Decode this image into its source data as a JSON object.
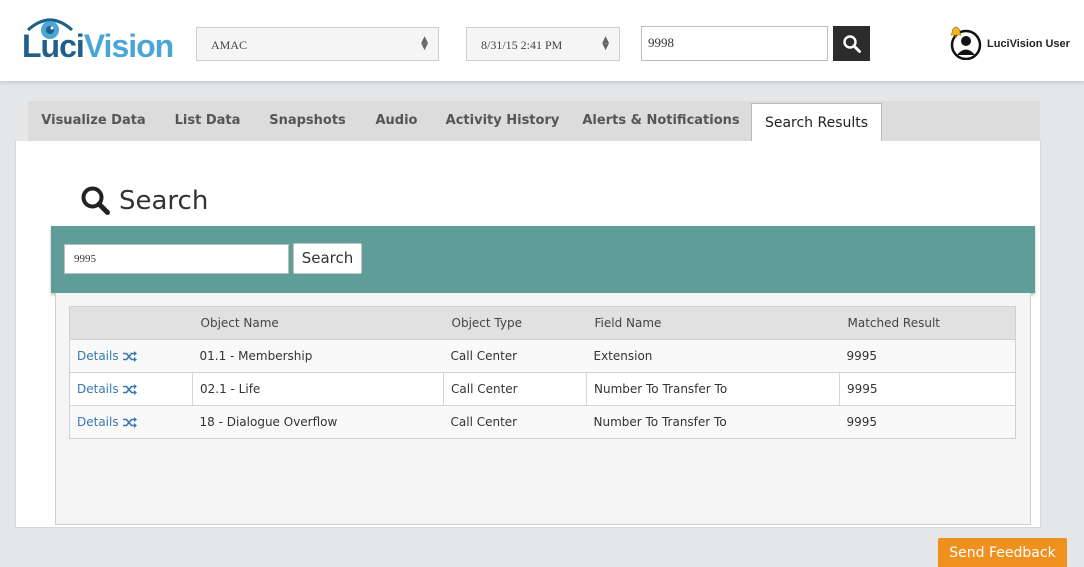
{
  "header": {
    "logo": {
      "luci": "Luci",
      "vision": "Vision"
    },
    "org_select": {
      "value": "AMAC"
    },
    "date_select": {
      "value": "8/31/15 2:41 PM"
    },
    "top_search": {
      "value": "9998"
    },
    "user": {
      "name": "LuciVision User"
    }
  },
  "tabs": [
    {
      "label": "Visualize Data"
    },
    {
      "label": "List Data"
    },
    {
      "label": "Snapshots"
    },
    {
      "label": "Audio"
    },
    {
      "label": "Activity History"
    },
    {
      "label": "Alerts & Notifications"
    },
    {
      "label": "Search Results",
      "active": true
    }
  ],
  "search": {
    "title": "Search",
    "input_value": "9995",
    "button_label": "Search"
  },
  "results": {
    "columns": [
      "",
      "Object Name",
      "Object Type",
      "Field Name",
      "Matched Result"
    ],
    "rows": [
      {
        "details": "Details",
        "object_name": "01.1 - Membership",
        "object_type": "Call Center",
        "field_name": "Extension",
        "matched": "9995"
      },
      {
        "details": "Details",
        "object_name": "02.1 - Life",
        "object_type": "Call Center",
        "field_name": "Number To Transfer To",
        "matched": "9995"
      },
      {
        "details": "Details",
        "object_name": "18 - Dialogue Overflow",
        "object_type": "Call Center",
        "field_name": "Number To Transfer To",
        "matched": "9995"
      }
    ]
  },
  "feedback": {
    "label": "Send Feedback"
  },
  "colors": {
    "teal_bar": "#5e9d98",
    "feedback": "#f0901f",
    "link": "#3779b0",
    "logo_dark": "#1f5f8b",
    "logo_light": "#4aa6d6"
  },
  "icons": [
    "eye-logo-icon",
    "chevron-updown-icon",
    "search-icon",
    "user-avatar-icon",
    "bell-icon",
    "shuffle-icon"
  ]
}
